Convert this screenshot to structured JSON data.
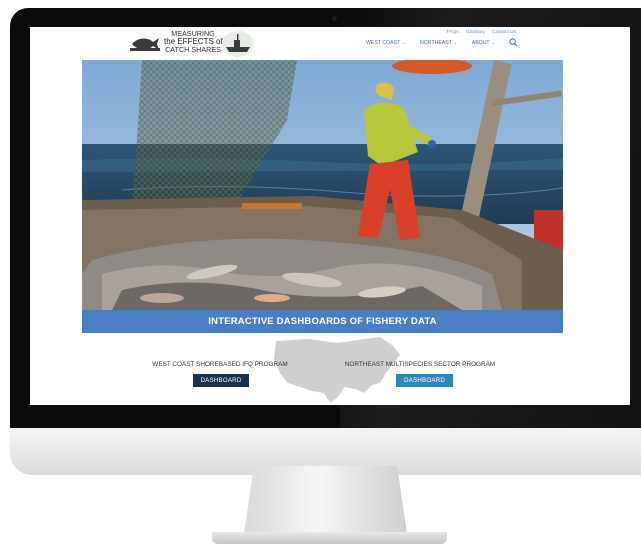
{
  "site": {
    "logo_lines": [
      "MEASURING",
      "the EFFECTS of",
      "CATCH SHARES"
    ]
  },
  "utility_nav": [
    "FAQs",
    "Glossary",
    "Contact Us"
  ],
  "main_nav": [
    {
      "label": "WEST COAST"
    },
    {
      "label": "NORTHEAST"
    },
    {
      "label": "ABOUT"
    }
  ],
  "hero": {
    "banner": "INTERACTIVE DASHBOARDS OF FISHERY DATA"
  },
  "programs": [
    {
      "title": "WEST COAST SHOREBASED IFQ PROGRAM",
      "button": "DASHBOARD",
      "color": "#17314f"
    },
    {
      "title": "NORTHEAST MULTISPECIES SECTOR PROGRAM",
      "button": "DASHBOARD",
      "color": "#2f86b8"
    }
  ],
  "icons": {
    "search": "search-icon",
    "chevron": "chevron-down-icon"
  },
  "colors": {
    "banner": "#4a7ec2",
    "nav_link": "#3a6fb0"
  }
}
